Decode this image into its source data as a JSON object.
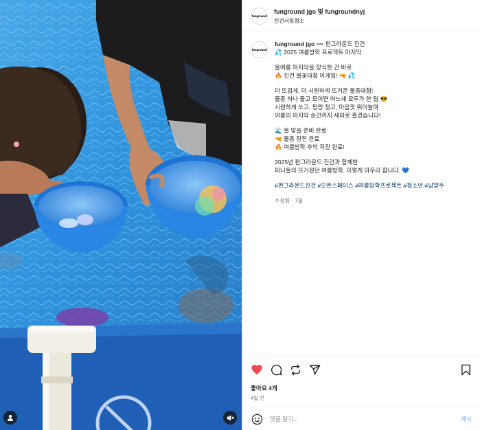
{
  "header": {
    "avatar_logo": "funground",
    "names": "funground jgo 및 fungroundnyj",
    "subtitle": "진건서동청소"
  },
  "caption": {
    "username": "funground jgo",
    "lines": [
      "〰️ 펀그라운드 진건",
      "💦 2025 여름방학 프로젝트 마지막",
      "",
      "올여름 마지막을 장식한 건 바로",
      "🔥 진건 불꽃대첩 이게임! 🔫 💦",
      "",
      "더 뜨겁게, 더 시원하게 뜨거운 물총대첩!",
      "물총 하나 들고 모이면 어느새 모두가 한 팀 😎",
      "시원하게 쏘고, 펑펑 젖고, 마음껏 뛰어놀며",
      "여름의 마지막 순간까지 새미로 즐겼습니다!",
      "",
      "🌊 물 맞을 준비 완료",
      "🔫 물총 장전 완료",
      "🔥 여름방학 추억 저장 완료!",
      "",
      "2025년 펀그라운드 진건과 함께한",
      "퍼니들의 뜨거웠던 여름방학, 이렇게 마무리 합니다. 💙"
    ],
    "hashtags": "#펀그라운드진건 #오픈스페이스 #여름방학프로젝트 #청소년 #남양주",
    "meta": "수정됨 · 7월"
  },
  "actions": {
    "likes": "좋아요 4개",
    "date": "4일 전"
  },
  "comment": {
    "placeholder": "댓글 달기...",
    "post_label": "게시"
  },
  "colors": {
    "heart": "#ed4956",
    "link": "#00376b",
    "post_disabled": "#8fc6f5",
    "pool_water": "#2e8fd6",
    "pool_frame": "#1f5fb5"
  },
  "media": {
    "user_icon": "person-icon",
    "mute_icon": "speaker-muted-icon"
  }
}
